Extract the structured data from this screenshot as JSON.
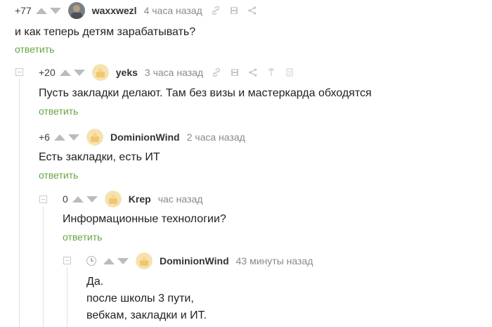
{
  "comments": [
    {
      "rating": "+77",
      "username": "waxxwezl",
      "time": "4 часа назад",
      "text": "и как теперь детям зарабатывать?",
      "reply_label": "ответить",
      "avatar": "photo-avatar"
    },
    {
      "rating": "+20",
      "username": "yeks",
      "time": "3 часа назад",
      "text": "Пусть закладки делают. Там без визы и мастеркарда обходятся",
      "reply_label": "ответить",
      "avatar": "default-avatar"
    },
    {
      "rating": "+6",
      "username": "DominionWind",
      "time": "2 часа назад",
      "text": "Есть закладки, есть ИТ",
      "reply_label": "ответить",
      "avatar": "default-avatar"
    },
    {
      "rating": "0",
      "username": "Krep",
      "time": "час назад",
      "text": "Информационные технологии?",
      "reply_label": "ответить",
      "avatar": "default-avatar"
    },
    {
      "username": "DominionWind",
      "time": "43 минуты назад",
      "text_lines": [
        "Да.",
        "после школы 3 пути,",
        "вебкам, закладки и ИТ."
      ],
      "avatar": "default-avatar",
      "rating_icon": "clock-icon"
    }
  ],
  "colors": {
    "reply_link": "#64a744",
    "arrow": "#b9bcbf",
    "time": "#8a8a8a",
    "avatar_bg": "#f4e3b0"
  },
  "icons": [
    "link-icon",
    "save-icon",
    "share-icon",
    "pin-icon",
    "more-icon",
    "collapse-icon",
    "upvote-icon",
    "downvote-icon",
    "clock-icon"
  ]
}
